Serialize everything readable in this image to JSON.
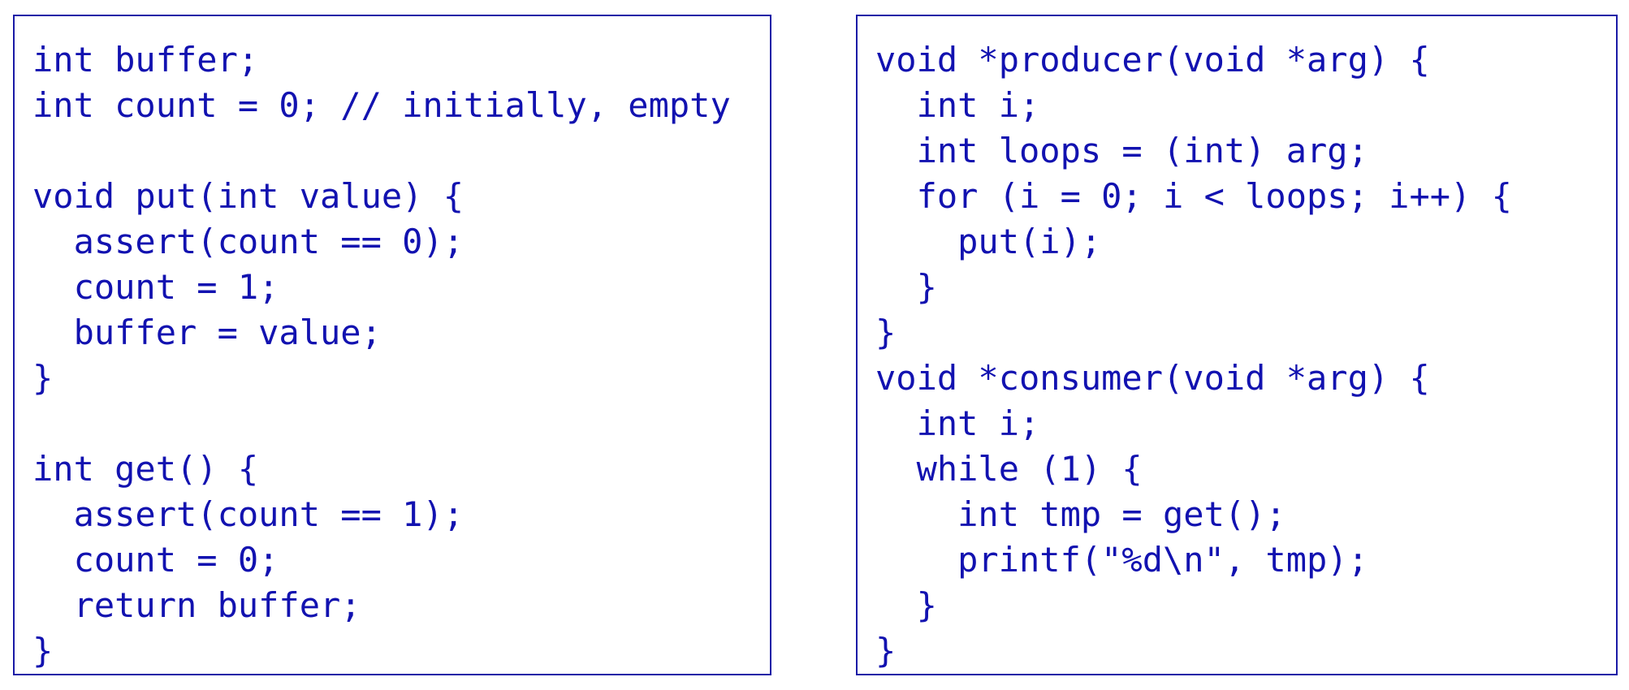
{
  "left_panel": {
    "lines": [
      "int buffer;",
      "int count = 0; // initially, empty",
      "",
      "void put(int value) {",
      "  assert(count == 0);",
      "  count = 1;",
      "  buffer = value;",
      "}",
      "",
      "int get() {",
      "  assert(count == 1);",
      "  count = 0;",
      "  return buffer;",
      "}"
    ]
  },
  "right_panel": {
    "lines": [
      "void *producer(void *arg) {",
      "  int i;",
      "  int loops = (int) arg;",
      "  for (i = 0; i < loops; i++) {",
      "    put(i);",
      "  }",
      "}",
      "void *consumer(void *arg) {",
      "  int i;",
      "  while (1) {",
      "    int tmp = get();",
      "    printf(\"%d\\n\", tmp);",
      "  }",
      "}"
    ]
  },
  "colors": {
    "code_text": "#1212b0",
    "border": "#1a1aa6"
  }
}
